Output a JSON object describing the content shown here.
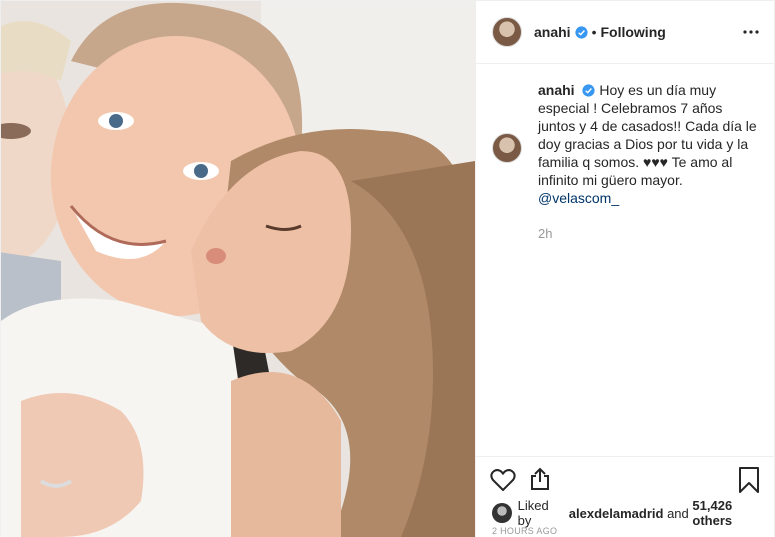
{
  "post": {
    "username": "anahi",
    "separator": "•",
    "follow_state": "Following",
    "caption": {
      "username": "anahi",
      "text": "Hoy es un día muy especial ! Celebramos 7 años juntos y 4 de casados!! Cada día le doy gracias a Dios por tu vida y la familia q somos. ♥♥♥ Te amo al infinito mi güero mayor.",
      "mention": "@velascom_",
      "time": "2h"
    },
    "likes": {
      "prefix": "Liked by",
      "liker": "alexdelamadrid",
      "conjunction": "and",
      "others": "51,426 others"
    },
    "timestamp": "2 HOURS AGO"
  },
  "icons": {
    "verified": "verified-badge-icon",
    "more": "more-options-icon",
    "like": "heart-icon",
    "share": "share-icon",
    "save": "bookmark-icon"
  },
  "colors": {
    "verified_blue": "#3897f0",
    "mention": "#003569",
    "muted": "#999999"
  }
}
